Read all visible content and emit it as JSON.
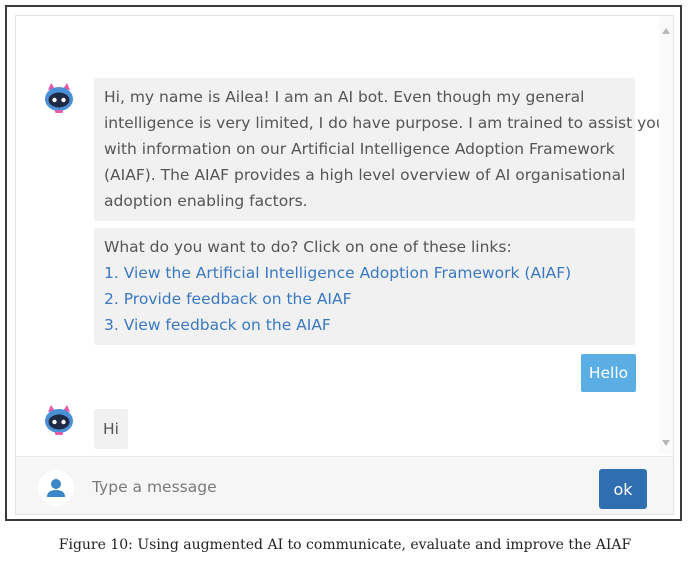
{
  "messages": {
    "bot_intro_lines": [
      "Hi, my name is Ailea! I am an AI bot. Even though my general",
      "intelligence is very limited, I do have purpose. I am trained to assist you",
      "with information on our Artificial Intelligence Adoption Framework",
      "(AIAF). The AIAF provides a high level overview of AI organisational",
      "adoption enabling factors."
    ],
    "bot_prompt": "What do you want to do? Click on one of these links:",
    "links": [
      "1. View the Artificial Intelligence Adoption Framework (AIAF)",
      "2. Provide feedback on the AIAF",
      "3. View feedback on the AIAF"
    ],
    "user_message": "Hello",
    "bot_reply": "Hi"
  },
  "composer": {
    "placeholder": "Type a message",
    "send_label": "ok"
  },
  "caption": "Figure 10: Using augmented AI to communicate, evaluate and improve the AIAF",
  "icons": {
    "bot_avatar": "robot-icon",
    "user_avatar": "user-icon"
  },
  "colors": {
    "link": "#3a78c2",
    "user_bubble": "#5aaee3",
    "send_button": "#2f6fb1",
    "bot_bubble": "#f1f1f1"
  }
}
